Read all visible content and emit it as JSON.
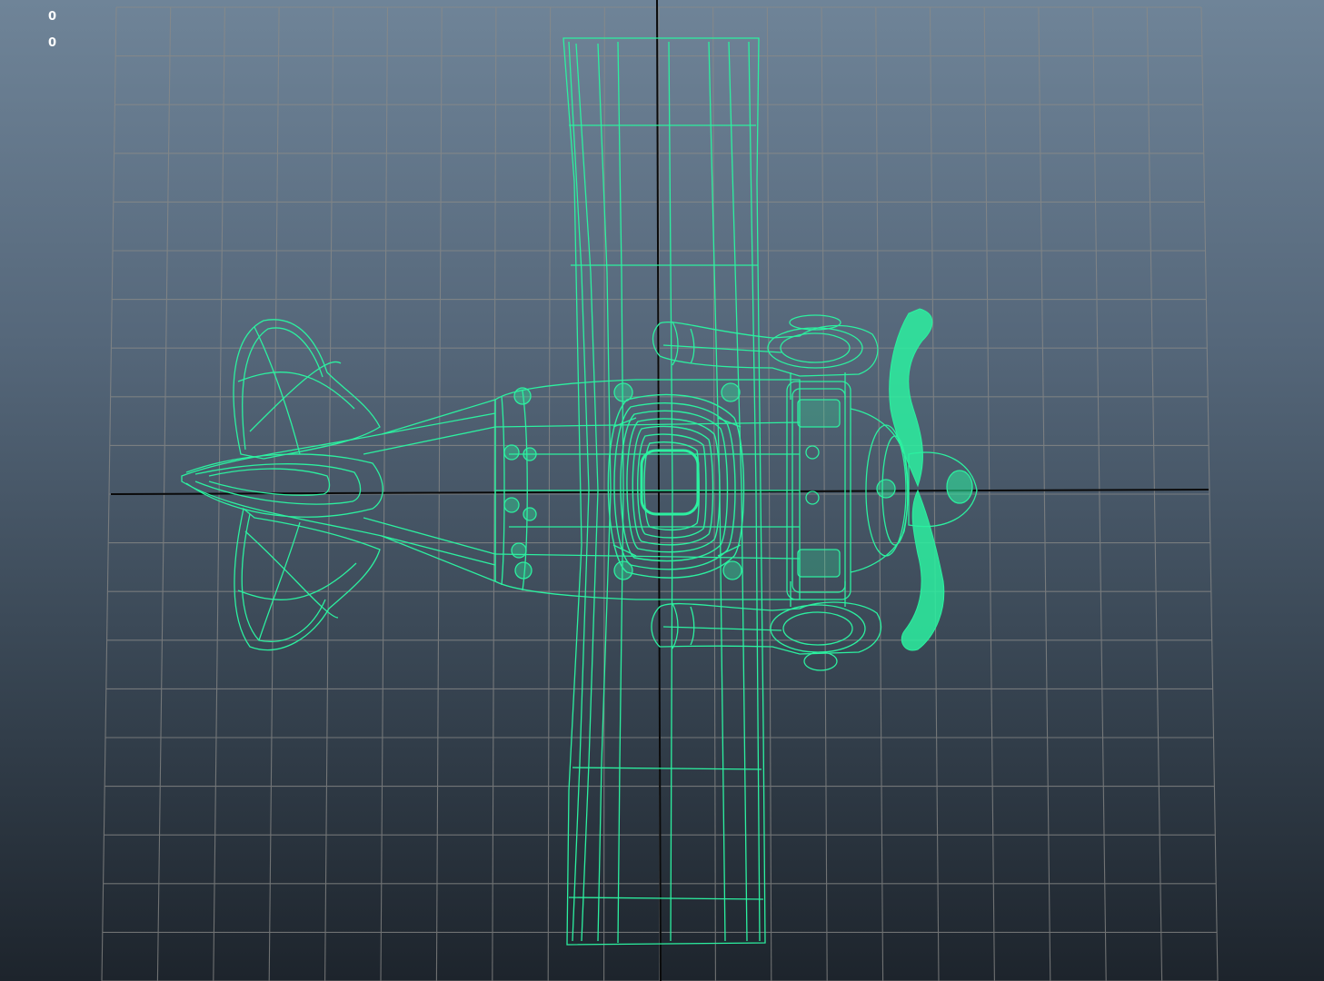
{
  "viewport": {
    "name": "top-orthographic-viewport",
    "colors": {
      "background_top": "#6f8498",
      "background_bottom": "#1d242c",
      "grid_line": "#8a8a88",
      "origin_axis": "#0a0a0a",
      "wireframe": "#2cf0a0"
    }
  },
  "hud": {
    "value_1": "0",
    "value_2": "0"
  },
  "model": {
    "object": "toy-airplane-wireframe",
    "view": "top"
  }
}
